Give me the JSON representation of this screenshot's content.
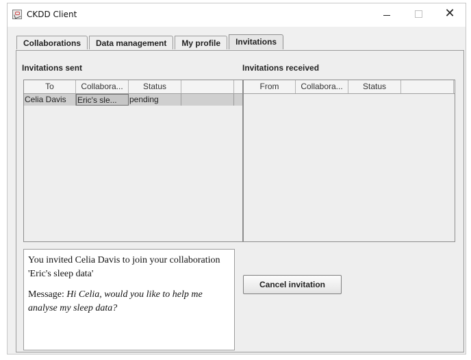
{
  "window": {
    "title": "CKDD Client",
    "close_glyph": "✕"
  },
  "tabs": [
    {
      "label": "Collaborations",
      "selected": false
    },
    {
      "label": "Data management",
      "selected": false
    },
    {
      "label": "My profile",
      "selected": false
    },
    {
      "label": "Invitations",
      "selected": true
    }
  ],
  "sent": {
    "label": "Invitations sent",
    "columns": [
      "To",
      "Collabora...",
      "Status",
      ""
    ],
    "rows": [
      {
        "to": "Celia Davis",
        "collaboration": "Eric's sle...",
        "status": "pending",
        "extra": ""
      }
    ]
  },
  "received": {
    "label": "Invitations received",
    "columns": [
      "From",
      "Collabora...",
      "Status",
      ""
    ],
    "rows": []
  },
  "detail": {
    "intro": "You invited Celia Davis to join your collaboration 'Eric's sleep data'",
    "message_label": "Message: ",
    "message_text": "Hi Celia, would you like to help me analyse my sleep data?"
  },
  "actions": {
    "cancel_label": "Cancel invitation"
  },
  "icons": {
    "app": "java-app-icon",
    "minimize": "minimize-icon",
    "maximize": "maximize-icon",
    "close": "close-icon"
  }
}
